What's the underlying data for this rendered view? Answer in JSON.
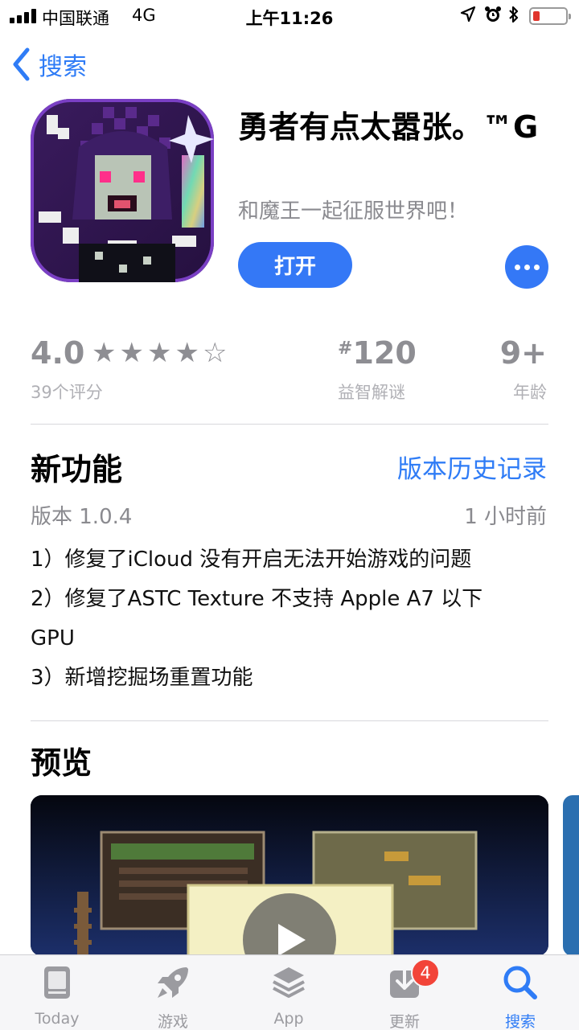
{
  "status_bar": {
    "carrier": "中国联通",
    "network": "4G",
    "time": "上午11:26"
  },
  "nav": {
    "back_label": "搜索"
  },
  "app": {
    "title": "勇者有点太嚣张。™G",
    "subtitle": "和魔王一起征服世界吧！",
    "open_label": "打开"
  },
  "ratings": {
    "score": "4.0",
    "stars_filled": 4,
    "stars_total": 5,
    "count_label": "39个评分",
    "rank_prefix": "#",
    "rank": "120",
    "category": "益智解谜",
    "age": "9+",
    "age_label": "年龄"
  },
  "whats_new": {
    "title": "新功能",
    "history_link": "版本历史记录",
    "version": "版本 1.0.4",
    "time_ago": "1 小时前",
    "notes": [
      "1）修复了iCloud 没有开启无法开始游戏的问题",
      "2）修复了ASTC Texture 不支持 Apple A7 以下",
      "GPU",
      "3）新增挖掘场重置功能"
    ]
  },
  "preview": {
    "title": "预览"
  },
  "tabbar": {
    "tabs": [
      {
        "label": "Today",
        "icon": "today-icon"
      },
      {
        "label": "游戏",
        "icon": "rocket-icon"
      },
      {
        "label": "App",
        "icon": "layers-icon"
      },
      {
        "label": "更新",
        "icon": "download-icon",
        "badge": "4"
      },
      {
        "label": "搜索",
        "icon": "search-icon",
        "active": true
      }
    ]
  },
  "colors": {
    "accent": "#3478f6",
    "badge": "#f24439",
    "battery_low": "#e0352c"
  }
}
